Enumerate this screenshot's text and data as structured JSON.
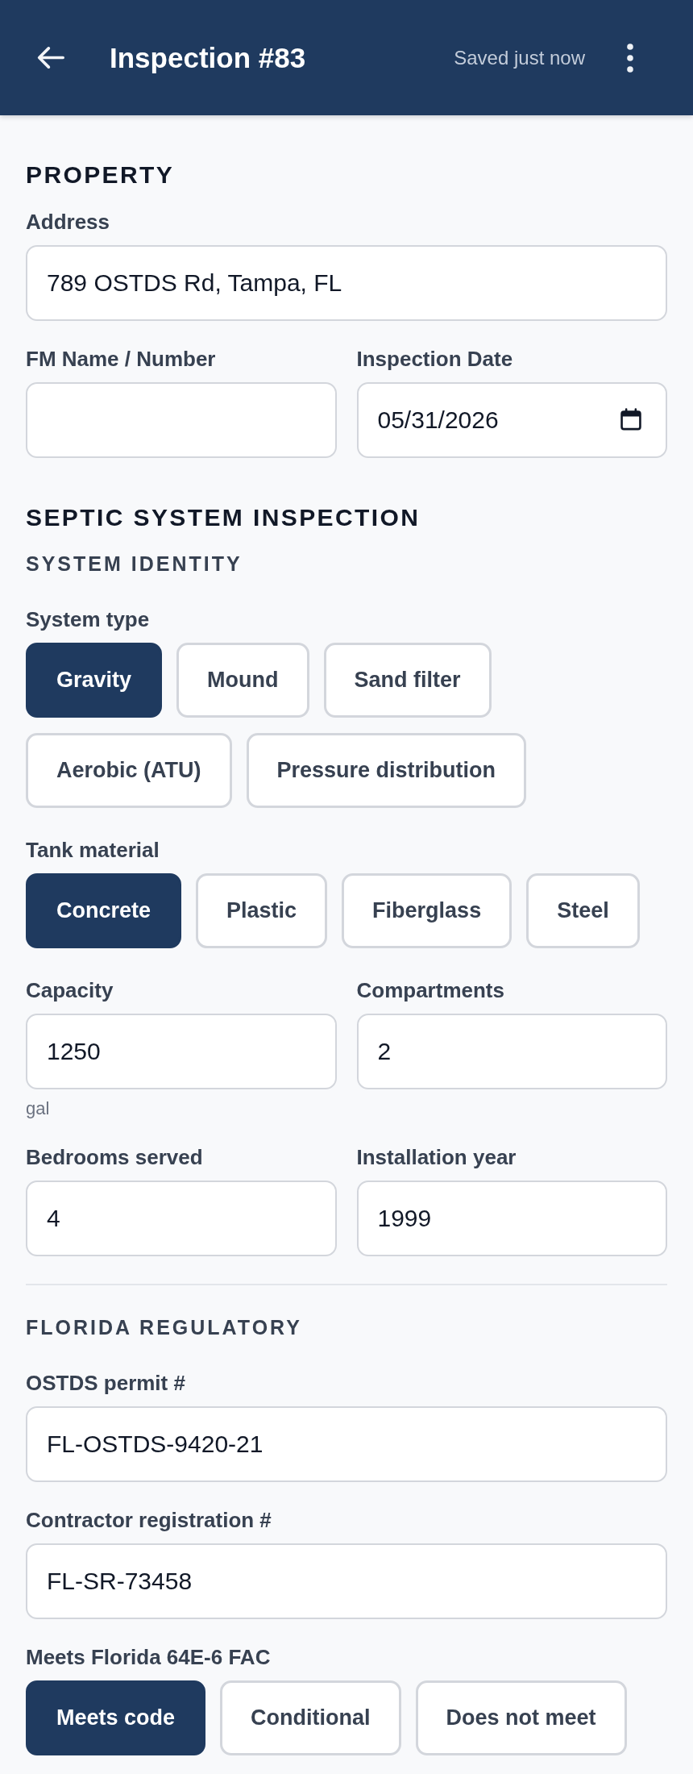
{
  "app_bar": {
    "title": "Inspection #83",
    "status": "Saved just now"
  },
  "sections": [
    {
      "title": "PROPERTY",
      "subsections": [
        {
          "blocks": [
            {
              "kind": "fields",
              "fields": [
                {
                  "label": "Address",
                  "value": "789 OSTDS Rd, Tampa, FL",
                  "kind": "text"
                }
              ]
            },
            {
              "kind": "fields",
              "fields": [
                {
                  "label": "FM Name / Number",
                  "kind": "text"
                },
                {
                  "label": "Inspection Date",
                  "value": "05/31/2026",
                  "kind": "date"
                }
              ]
            }
          ]
        }
      ]
    },
    {
      "title": "SEPTIC SYSTEM INSPECTION",
      "subsections": [
        {
          "title": "SYSTEM IDENTITY",
          "blocks": [
            {
              "kind": "choices",
              "label": "System type",
              "options": [
                {
                  "label": "Gravity",
                  "selected": true
                },
                {
                  "label": "Mound",
                  "selected": false
                },
                {
                  "label": "Sand filter",
                  "selected": false
                },
                {
                  "label": "Aerobic (ATU)",
                  "selected": false
                },
                {
                  "label": "Pressure distribution",
                  "selected": false
                }
              ]
            },
            {
              "kind": "choices",
              "label": "Tank material",
              "options": [
                {
                  "label": "Concrete",
                  "selected": true
                },
                {
                  "label": "Plastic",
                  "selected": false
                },
                {
                  "label": "Fiberglass",
                  "selected": false
                },
                {
                  "label": "Steel",
                  "selected": false
                }
              ]
            },
            {
              "kind": "fields",
              "fields": [
                {
                  "label": "Capacity",
                  "value": "1250",
                  "unit": "gal",
                  "kind": "text"
                },
                {
                  "label": "Compartments",
                  "value": "2",
                  "kind": "text"
                }
              ]
            },
            {
              "kind": "fields",
              "fields": [
                {
                  "label": "Bedrooms served",
                  "value": "4",
                  "kind": "text"
                },
                {
                  "label": "Installation year",
                  "value": "1999",
                  "kind": "text"
                }
              ]
            }
          ]
        },
        {
          "title": "FLORIDA REGULATORY",
          "blocks": [
            {
              "kind": "fields",
              "fields": [
                {
                  "label": "OSTDS permit #",
                  "value": "FL-OSTDS-9420-21",
                  "kind": "text"
                }
              ]
            },
            {
              "kind": "fields",
              "fields": [
                {
                  "label": "Contractor registration #",
                  "value": "FL-SR-73458",
                  "kind": "text"
                }
              ]
            },
            {
              "kind": "choices",
              "label": "Meets Florida 64E-6 FAC",
              "options": [
                {
                  "label": "Meets code",
                  "selected": true
                },
                {
                  "label": "Conditional",
                  "selected": false
                },
                {
                  "label": "Does not meet",
                  "selected": false
                }
              ]
            }
          ]
        }
      ]
    }
  ]
}
